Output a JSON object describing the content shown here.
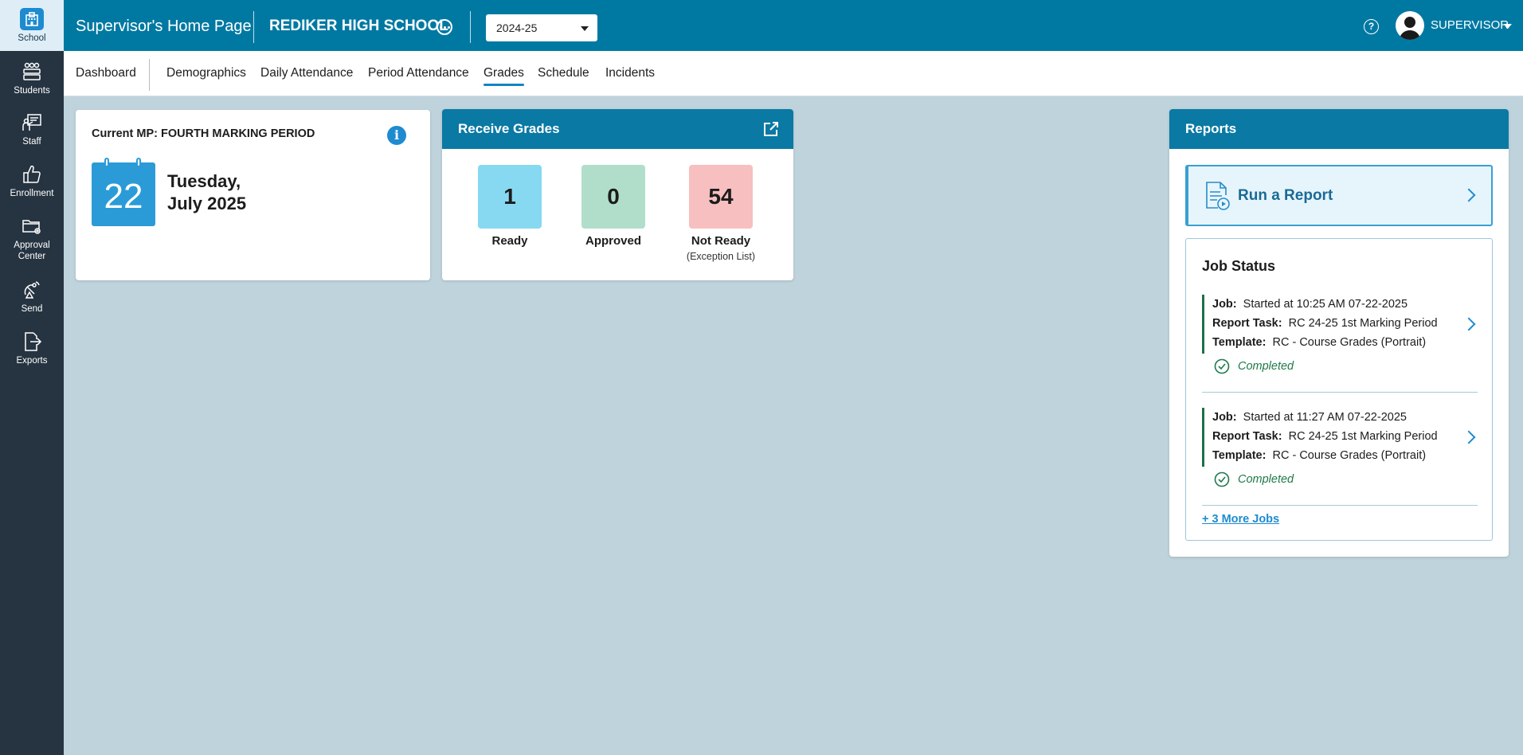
{
  "rail": {
    "items": [
      {
        "label": "School",
        "icon": "school-icon"
      },
      {
        "label": "Students",
        "icon": "students-icon"
      },
      {
        "label": "Staff",
        "icon": "staff-icon"
      },
      {
        "label": "Enrollment",
        "icon": "thumbs-up-icon"
      },
      {
        "label": "Approval Center",
        "icon": "folder-gear-icon"
      },
      {
        "label": "Send",
        "icon": "satellite-icon"
      },
      {
        "label": "Exports",
        "icon": "export-file-icon"
      }
    ]
  },
  "header": {
    "title": "Supervisor's Home Page",
    "school": "REDIKER HIGH SCHOOL",
    "year": "2024-25",
    "help_glyph": "?",
    "user": "SUPERVISOR"
  },
  "subnav": {
    "items": [
      "Dashboard",
      "Demographics",
      "Daily Attendance",
      "Period Attendance",
      "Grades",
      "Schedule",
      "Incidents"
    ],
    "active": "Grades"
  },
  "marking_period": {
    "label": "Current MP: FOURTH MARKING PERIOD",
    "day": "22",
    "weekday": "Tuesday,",
    "month_year": "July 2025",
    "info_glyph": "i"
  },
  "receive_grades": {
    "title": "Receive Grades",
    "stats": [
      {
        "value": "1",
        "label": "Ready",
        "sub": "",
        "color": "#86d9f1"
      },
      {
        "value": "0",
        "label": "Approved",
        "sub": "",
        "color": "#b1decb"
      },
      {
        "value": "54",
        "label": "Not Ready",
        "sub": "(Exception List)",
        "color": "#f7bfbf"
      }
    ]
  },
  "reports": {
    "title": "Reports",
    "run_label": "Run a Report",
    "job_status_title": "Job Status",
    "jobs": [
      {
        "job_key": "Job:",
        "job": "Started at 10:25 AM 07-22-2025",
        "task_key": "Report Task:",
        "task": "RC 24-25 1st Marking Period",
        "template_key": "Template:",
        "template": "RC - Course Grades (Portrait)",
        "status": "Completed"
      },
      {
        "job_key": "Job:",
        "job": "Started at 11:27 AM 07-22-2025",
        "task_key": "Report Task:",
        "task": "RC 24-25 1st Marking Period",
        "template_key": "Template:",
        "template": "RC - Course Grades (Portrait)",
        "status": "Completed"
      }
    ],
    "more_jobs": "+ 3 More Jobs"
  },
  "colors": {
    "header": "#0079a2",
    "rail": "#263441",
    "background": "#bfd3dd",
    "accent": "#1e8bd0",
    "completed": "#1e7a4a"
  }
}
